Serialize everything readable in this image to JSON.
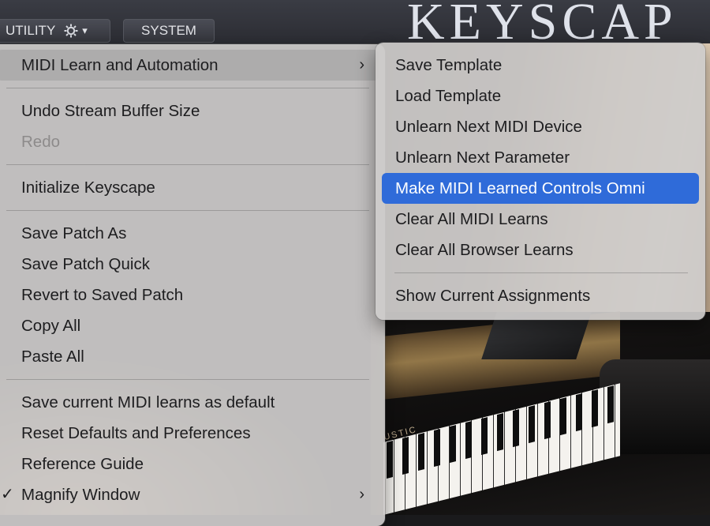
{
  "toolbar": {
    "utility_label": "UTILITY",
    "utility_icon": "gear-icon",
    "utility_chevron": "▾",
    "system_label": "SYSTEM"
  },
  "logo": {
    "text": "KEYSCAP"
  },
  "background": {
    "brand_text": "USTIC"
  },
  "main_menu": {
    "items": [
      {
        "label": "MIDI Learn and Automation",
        "arrow": "›"
      },
      {
        "label": "Undo Stream Buffer Size"
      },
      {
        "label": "Redo"
      },
      {
        "label": "Initialize Keyscape"
      },
      {
        "label": "Save Patch As"
      },
      {
        "label": "Save Patch Quick"
      },
      {
        "label": "Revert to Saved Patch"
      },
      {
        "label": "Copy All"
      },
      {
        "label": "Paste All"
      },
      {
        "label": "Save current MIDI learns as default"
      },
      {
        "label": "Reset Defaults and Preferences"
      },
      {
        "label": "Reference Guide"
      },
      {
        "label": "Magnify Window",
        "arrow": "›",
        "check": "✓"
      }
    ]
  },
  "sub_menu": {
    "items": [
      {
        "label": "Save Template"
      },
      {
        "label": "Load Template"
      },
      {
        "label": "Unlearn Next MIDI Device"
      },
      {
        "label": "Unlearn Next Parameter"
      },
      {
        "label": "Make MIDI Learned Controls Omni"
      },
      {
        "label": "Clear All MIDI Learns"
      },
      {
        "label": "Clear All Browser Learns"
      },
      {
        "label": "Show Current Assignments"
      }
    ]
  },
  "colors": {
    "selection": "#2f6bd9",
    "menu_bg": "#cecbca",
    "disabled_text": "#8d8b8b"
  }
}
